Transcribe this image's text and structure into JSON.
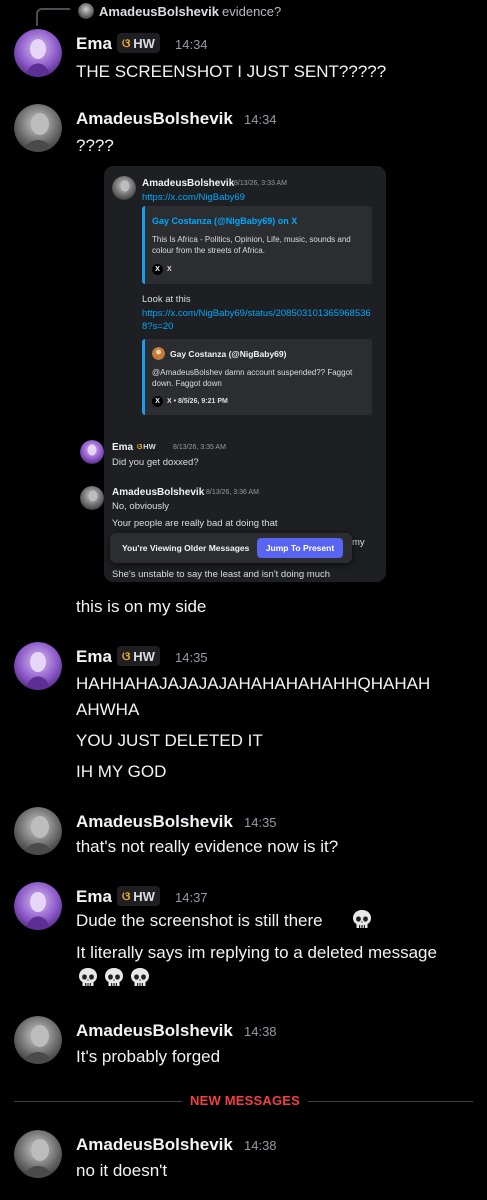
{
  "users": {
    "ema": "Ema",
    "amadeus": "AmadeusBolshevik"
  },
  "badge": {
    "icon": "butterfly-icon",
    "text": "HW"
  },
  "reply": {
    "author": "AmadeusBolshevik",
    "text": "evidence?"
  },
  "messages": [
    {
      "author": "Ema",
      "time": "14:34",
      "lines": [
        "THE SCREENSHOT I JUST SENT?????"
      ]
    },
    {
      "author": "AmadeusBolshevik",
      "time": "14:34",
      "lines": [
        "????",
        "this is on my side"
      ]
    },
    {
      "author": "Ema",
      "time": "14:35",
      "lines": [
        "HAHHAHAJAJAJAJAHAHAHAHAHHQHAHAH",
        "AHWHA",
        "YOU JUST DELETED IT",
        "IH MY GOD"
      ]
    },
    {
      "author": "AmadeusBolshevik",
      "time": "14:35",
      "lines": [
        "that's not really evidence now is it?"
      ]
    },
    {
      "author": "Ema",
      "time": "14:37",
      "lines": [
        "Dude the screenshot is still there",
        "It literally says im replying to a deleted message"
      ]
    },
    {
      "author": "AmadeusBolshevik",
      "time": "14:38",
      "lines": [
        "It's probably forged"
      ]
    },
    {
      "author": "AmadeusBolshevik",
      "time": "14:38",
      "lines": [
        "no it doesn't"
      ]
    }
  ],
  "divider": "NEW MESSAGES",
  "screenshot": {
    "msg1": {
      "author": "AmadeusBolshevik",
      "time": "8/13/26, 3:33 AM",
      "link": "https://x.com/NigBaby69",
      "embed_title": "Gay Costanza (@NigBaby69) on X",
      "embed_desc": [
        "This Is Africa - Politics, Opinion, Life, music, sounds and",
        "colour from the streets of Africa."
      ],
      "embed_footer": "X",
      "text": "Look at this",
      "link2": [
        "https://x.com/NigBaby69/status/208503101365968536",
        "8?s=20"
      ],
      "embed2_author": "Gay Costanza (@NigBaby69)",
      "embed2_desc": [
        "@AmadeusBolshev damn account suspended?? Faggot",
        "down. Faggot down"
      ],
      "embed2_footer": "X • 8/5/26, 9:21 PM"
    },
    "msg2": {
      "author": "Ema",
      "badge": "HW",
      "time": "8/13/26, 3:35 AM",
      "text": "Did you get doxxed?"
    },
    "msg3": {
      "author": "AmadeusBolshevik",
      "time": "8/13/26, 3:36 AM",
      "lines": [
        "No, obviously",
        "Your people are really bad at doing that"
      ],
      "cut": "my",
      "last": "She's unstable to say the least and isn't doing much"
    },
    "older_bar": {
      "text": "You're Viewing Older Messages",
      "button": "Jump To Present"
    }
  }
}
